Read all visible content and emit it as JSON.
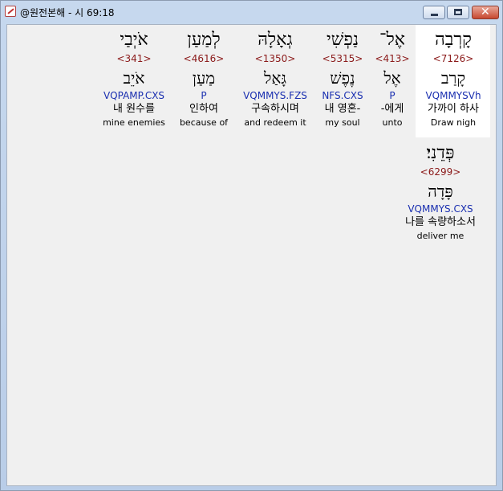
{
  "window": {
    "title": "@원전본해 - 시 69:18",
    "close_glyph": "✕"
  },
  "words": [
    {
      "hebrew": "קָרְבָה",
      "strong": "<7126>",
      "lexeme": "קָרַב",
      "parse": "VQMMYSVh",
      "korean": "가까이 하사",
      "english": "Draw nigh"
    },
    {
      "hebrew": "אֶל־",
      "strong": "<413>",
      "lexeme": "אֶל",
      "parse": "P",
      "korean": "-에게",
      "english": "unto"
    },
    {
      "hebrew": "נַפְשִׁי",
      "strong": "<5315>",
      "lexeme": "נֶפֶשׁ",
      "parse": "NFS.CXS",
      "korean": "내 영혼-",
      "english": "my soul"
    },
    {
      "hebrew": "גְאָלָהּ",
      "strong": "<1350>",
      "lexeme": "גָּאַל",
      "parse": "VQMMYS.FZS",
      "korean": "구속하시며",
      "english": "and redeem it"
    },
    {
      "hebrew": "לְמַעַן",
      "strong": "<4616>",
      "lexeme": "מַעַן",
      "parse": "P",
      "korean": "인하여",
      "english": "because of"
    },
    {
      "hebrew": "אֹיְבַי",
      "strong": "<341>",
      "lexeme": "אֹיֵב",
      "parse": "VQPAMP.CXS",
      "korean": "내 원수를",
      "english": "mine enemies"
    },
    {
      "hebrew": "פְּדֵנִי׃",
      "strong": "<6299>",
      "lexeme": "פָּדָה",
      "parse": "VQMMYS.CXS",
      "korean": "나를 속량하소서",
      "english": "deliver me"
    }
  ]
}
